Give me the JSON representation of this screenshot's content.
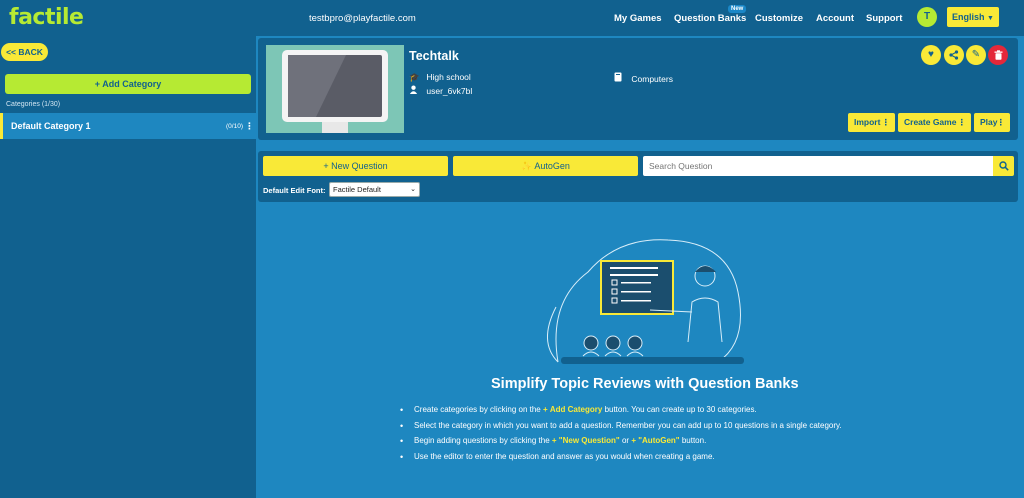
{
  "nav": {
    "logo": "factile",
    "email": "testbpro@playfactile.com",
    "links": [
      "My Games",
      "Question Banks",
      "Customize",
      "Account",
      "Support"
    ],
    "new_badge": "New",
    "avatar_letter": "T",
    "language": "English"
  },
  "sidebar": {
    "back_label": "<< BACK",
    "add_category_label": "Add Category",
    "categories_label": "Categories",
    "categories_count": "(1/30)",
    "categories": [
      {
        "name": "Default Category 1",
        "count": "(0/10)"
      }
    ]
  },
  "bank": {
    "title": "Techtalk",
    "level": "High school",
    "owner": "user_6vk7bl",
    "subject": "Computers",
    "buttons": {
      "import": "Import",
      "create_game": "Create Game",
      "play": "Play"
    }
  },
  "toolbar": {
    "new_question_label": "New Question",
    "autogen_label": "AutoGen",
    "search_placeholder": "Search Question",
    "font_label": "Default Edit Font:",
    "font_value": "Factile Default"
  },
  "empty_state": {
    "heading": "Simplify Topic Reviews with Question Banks",
    "line1_pre": "Create categories by clicking on the",
    "line1_hl": "Add Category",
    "line1_post": "button. You can create up to 30 categories.",
    "line2": "Select the category in which you want to add a question. Remember you can add up to 10 questions in a single category.",
    "line3_pre": "Begin adding questions by clicking the",
    "line3_hl1": "\"New Question\"",
    "line3_mid": "or",
    "line3_hl2": "\"AutoGen\"",
    "line3_post": "button.",
    "line4": "Use the editor to enter the question and answer as you would when creating a game."
  },
  "colors": {
    "background": "#1e87c0",
    "panel": "#11618f",
    "accent_yellow": "#f9e937",
    "accent_green": "#b6ea33",
    "delete_red": "#e4283a"
  },
  "icons": [
    "graduation-cap-icon",
    "user-icon",
    "book-icon",
    "heart-icon",
    "share-icon",
    "edit-icon",
    "trash-icon",
    "plus-icon",
    "magic-wand-icon",
    "search-icon",
    "kebab-menu-icon",
    "chevron-down-icon"
  ]
}
